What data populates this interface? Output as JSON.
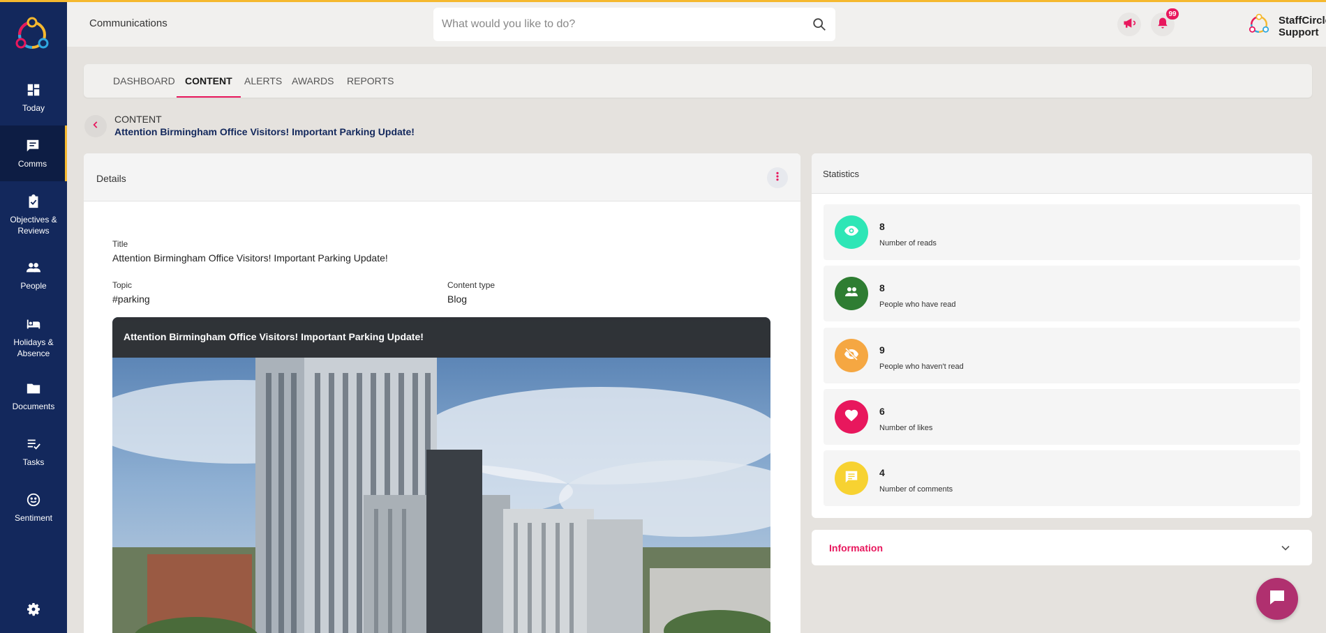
{
  "app": {
    "accent_color": "#f5b82e",
    "brand_pink": "#e8175d",
    "sidebar_color": "#13285c"
  },
  "sidebar": {
    "items": [
      {
        "label": "Today",
        "icon": "dashboard-icon"
      },
      {
        "label": "Comms",
        "icon": "chat-icon"
      },
      {
        "label": "Objectives &\nReviews",
        "icon": "clipboard-check-icon"
      },
      {
        "label": "People",
        "icon": "people-icon"
      },
      {
        "label": "Holidays &\nAbsence",
        "icon": "bed-icon"
      },
      {
        "label": "Documents",
        "icon": "folder-icon"
      },
      {
        "label": "Tasks",
        "icon": "task-list-icon"
      },
      {
        "label": "Sentiment",
        "icon": "smiley-icon"
      }
    ],
    "active_index": 1
  },
  "header": {
    "title": "Communications",
    "search_placeholder": "What would you like to do?",
    "notification_count": "99",
    "user_name": "StaffCircle Support"
  },
  "tabs": [
    {
      "label": "DASHBOARD"
    },
    {
      "label": "CONTENT"
    },
    {
      "label": "ALERTS"
    },
    {
      "label": "AWARDS"
    },
    {
      "label": "REPORTS"
    }
  ],
  "active_tab": "CONTENT",
  "breadcrumb": {
    "section": "CONTENT",
    "title": "Attention Birmingham Office Visitors! Important Parking Update!"
  },
  "details": {
    "header": "Details",
    "title_label": "Title",
    "title_value": "Attention Birmingham Office Visitors! Important Parking Update!",
    "topic_label": "Topic",
    "topic_value": "#parking",
    "content_type_label": "Content type",
    "content_type_value": "Blog",
    "hero_title": "Attention Birmingham Office Visitors! Important Parking Update!"
  },
  "statistics": {
    "header": "Statistics",
    "items": [
      {
        "value": "8",
        "label": "Number of reads",
        "color": "#2ee6b6",
        "icon": "eye-icon"
      },
      {
        "value": "8",
        "label": "People who have read",
        "color": "#2e7d32",
        "icon": "people-icon"
      },
      {
        "value": "9",
        "label": "People who haven't read",
        "color": "#f5a742",
        "icon": "eye-off-icon"
      },
      {
        "value": "6",
        "label": "Number of likes",
        "color": "#e8175d",
        "icon": "heart-icon"
      },
      {
        "value": "4",
        "label": "Number of comments",
        "color": "#f7d231",
        "icon": "comment-icon"
      }
    ]
  },
  "information": {
    "title": "Information"
  }
}
